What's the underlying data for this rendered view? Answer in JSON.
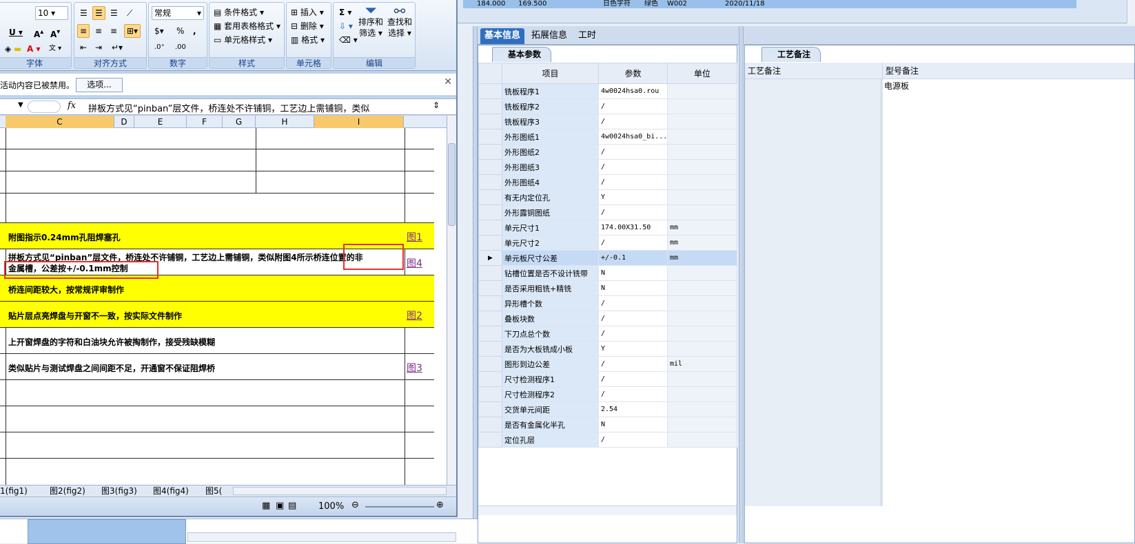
{
  "background_row": {
    "a": "184.000",
    "b": "169.500",
    "c": "日色字符",
    "d": "绿色",
    "e": "W002",
    "f": "2020/11/18"
  },
  "tabs": [
    "基本信息",
    "拓展信息",
    "工时"
  ],
  "left_subtab": "基本参数",
  "grid": {
    "headers": {
      "item": "项目",
      "param": "参数",
      "unit": "单位"
    },
    "rows": [
      {
        "item": "铣板程序1",
        "param": "4w0024hsa0.rou",
        "unit": ""
      },
      {
        "item": "铣板程序2",
        "param": "/",
        "unit": ""
      },
      {
        "item": "铣板程序3",
        "param": "/",
        "unit": ""
      },
      {
        "item": "外形图纸1",
        "param": "4w0024hsa0_bi...",
        "unit": ""
      },
      {
        "item": "外形图纸2",
        "param": "/",
        "unit": ""
      },
      {
        "item": "外形图纸3",
        "param": "/",
        "unit": ""
      },
      {
        "item": "外形图纸4",
        "param": "/",
        "unit": ""
      },
      {
        "item": "有无内定位孔",
        "param": "Y",
        "unit": ""
      },
      {
        "item": "外形露铜图纸",
        "param": "/",
        "unit": ""
      },
      {
        "item": "单元尺寸1",
        "param": "174.00X31.50",
        "unit": "mm"
      },
      {
        "item": "单元尺寸2",
        "param": "/",
        "unit": "mm"
      },
      {
        "item": "单元板尺寸公差",
        "param": "+/-0.1",
        "unit": "mm"
      },
      {
        "item": "钻槽位置是否不设计铣带",
        "param": "N",
        "unit": ""
      },
      {
        "item": "是否采用粗铣+精铣",
        "param": "N",
        "unit": ""
      },
      {
        "item": "异形槽个数",
        "param": "/",
        "unit": ""
      },
      {
        "item": "叠板块数",
        "param": "/",
        "unit": ""
      },
      {
        "item": "下刀点总个数",
        "param": "/",
        "unit": ""
      },
      {
        "item": "是否为大板铣成小板",
        "param": "Y",
        "unit": ""
      },
      {
        "item": "图形到边公差",
        "param": "/",
        "unit": "mil"
      },
      {
        "item": "尺寸检测程序1",
        "param": "/",
        "unit": ""
      },
      {
        "item": "尺寸检测程序2",
        "param": "/",
        "unit": ""
      },
      {
        "item": "交货单元间距",
        "param": "2.54",
        "unit": ""
      },
      {
        "item": "是否有金属化半孔",
        "param": "N",
        "unit": ""
      },
      {
        "item": "定位孔层",
        "param": "/",
        "unit": ""
      }
    ]
  },
  "right_subtab": "工艺备注",
  "right_headers": {
    "col1": "工艺备注",
    "col2": "型号备注"
  },
  "right_value": "电源板",
  "excel": {
    "font_size": "10",
    "number_format": "常规",
    "groups": {
      "font": "字体",
      "align": "对齐方式",
      "number": "数字",
      "style": "样式",
      "cells": "单元格",
      "edit": "编辑"
    },
    "buttons": {
      "cond_format": "条件格式",
      "table_format": "套用表格格式",
      "cell_style": "单元格样式",
      "insert": "插入",
      "delete": "删除",
      "format": "格式",
      "sort_filter_1": "排序和",
      "sort_filter_2": "筛选",
      "find_select_1": "查找和",
      "find_select_2": "选择"
    },
    "infobar_msg": "活动内容已被禁用。",
    "infobar_option": "选项...",
    "formula_text": "拼板方式见“pinban”层文件，桥连处不许铺铜，工艺边上需铺铜，类似",
    "columns": [
      "C",
      "D",
      "E",
      "F",
      "G",
      "H",
      "I"
    ],
    "rows": {
      "r1": "附图指示0.24mm孔阻焊塞孔",
      "r2a": "拼板方式见“pinban”层文件，桥连处不许铺铜，工艺边上需铺铜，类似附图4所示桥连位置的非",
      "r2b": "金属槽，公差按+/-0.1mm控制",
      "r3": "桥连间距较大，按常规评审制作",
      "r4": "贴片层点亮焊盘与开窗不一致，按实际文件制作",
      "r5": "上开窗焊盘的字符和白油块允许被掏制作，接受残缺模糊",
      "r6": "类似贴片与测试焊盘之间间距不足，开通窗不保证阻焊桥"
    },
    "links": [
      "图1",
      "图4",
      "图2",
      "图3"
    ],
    "sheet_tabs": [
      "1(fig1)",
      "图2(fig2)",
      "图3(fig3)",
      "图4(fig4)",
      "图5("
    ],
    "zoom": "100%"
  }
}
